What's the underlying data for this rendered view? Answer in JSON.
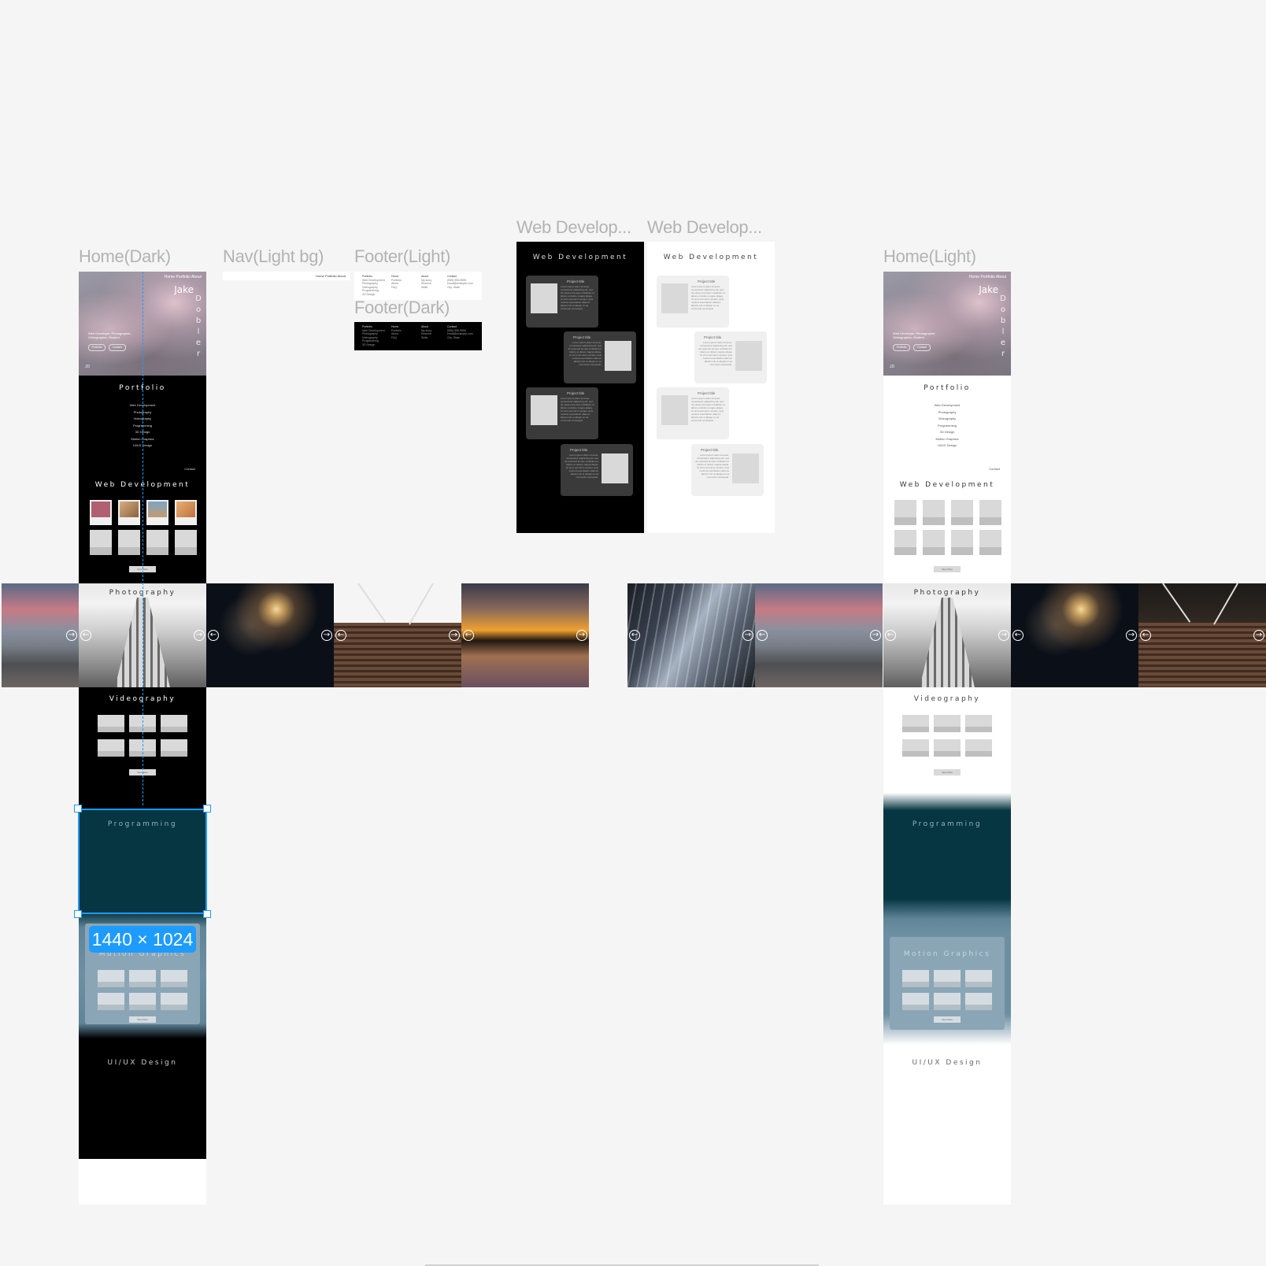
{
  "frame_labels": {
    "home_dark": "Home(Dark)",
    "nav_light": "Nav(Light bg)",
    "footer_light": "Footer(Light)",
    "footer_dark": "Footer(Dark)",
    "webdev_dark": "Web Develop...",
    "webdev_light": "Web Develop...",
    "home_light": "Home(Light)"
  },
  "hero": {
    "nav": "Home  Portfolio  About",
    "name": "Jake",
    "vertical_letters": [
      "D",
      "o",
      "b",
      "l",
      "e",
      "r"
    ],
    "tagline": "Web Developer, Photographer, Videographer, Student",
    "btn_portfolio": "Portfolio",
    "btn_contact": "Contact",
    "logo": "JD"
  },
  "nav_light": {
    "links": "Home  Portfolio  About"
  },
  "footer": {
    "columns": [
      {
        "head": "Portfolio",
        "lines": [
          "Web Development",
          "Photography",
          "Videography",
          "Programming",
          "3D Design",
          "UI/UX"
        ]
      },
      {
        "head": "Home",
        "lines": [
          "Portfolio",
          "About",
          "FAQ"
        ]
      },
      {
        "head": "About",
        "lines": [
          "My story",
          "Resume",
          "Skills"
        ]
      },
      {
        "head": "Contact",
        "lines": [
          "(555) 555-5555",
          "email@example.com",
          "City, State"
        ]
      }
    ]
  },
  "sections": {
    "portfolio": "Portfolio",
    "portfolio_items": [
      "Web Development",
      "Photography",
      "Videography",
      "Programming",
      "3D Design",
      "Motion Graphics",
      "UI/UX Design"
    ],
    "contact_link": "Contact",
    "web_development": "Web Development",
    "view_more": "View More",
    "photography": "Photography",
    "videography": "Videography",
    "programming": "Programming",
    "motion_graphics": "Motion Graphics",
    "uiux": "UI/UX Design"
  },
  "webdev_page": {
    "title": "Web Development",
    "project_title": "Project title",
    "project_text": "Lorem ipsum dolor sit amet, consectetur adipiscing elit, sed do eiusmod tempor incididunt ut labore et dolore magna aliqua. Ut enim ad minim veniam, quis nostrud exercitation ullamco laboris nisi ut aliquip ex ea commodo consequat."
  },
  "selection": {
    "size_badge": "1440 × 1024"
  },
  "arrows": {
    "left": "←",
    "right": "→"
  },
  "colors": {
    "canvas": "#f5f5f5",
    "dark_bg": "#000000",
    "light_bg": "#ffffff",
    "programming_bg": "#063642",
    "motion_bg": "#6e8fa2",
    "selection_blue": "#1e9bff"
  }
}
